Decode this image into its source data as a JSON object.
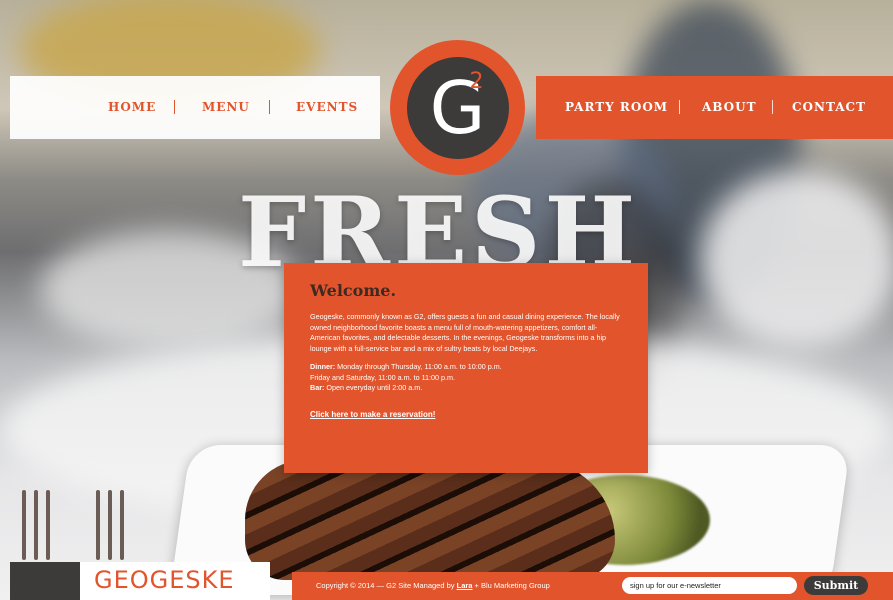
{
  "nav": {
    "left": [
      "HOME",
      "MENU",
      "EVENTS"
    ],
    "right": [
      "PARTY ROOM",
      "ABOUT",
      "CONTACT"
    ]
  },
  "logo": {
    "letter": "G",
    "superscript": "2"
  },
  "hero": {
    "heading": "FRESH"
  },
  "welcome": {
    "title": "Welcome.",
    "body": "Geogeske, commonly known as G2, offers guests a fun and casual dining experience. The locally owned neighborhood favorite boasts a menu full of mouth-watering appetizers, comfort all-American favorites, and delectable desserts. In the evenings, Geogeske transforms into a hip lounge with a full-service bar and a mix of sultry beats by local Deejays.",
    "dinner_label": "Dinner:",
    "dinner_hours": " Monday through Thursday, 11:00 a.m. to 10:00 p.m.",
    "weekend_hours": "Friday and Saturday, 11:00 a.m. to 11:00 p.m.",
    "bar_label": "Bar:",
    "bar_hours": " Open everyday until 2:00 a.m.",
    "reservation_link": "Click here to make a reservation!"
  },
  "footer": {
    "logo_text": "GEOGESKE",
    "copyright": "Copyright © 2014 — G2   Site Managed by ",
    "managed_link": "Lara",
    "managed_suffix": " + Blu Marketing Group",
    "newsletter_placeholder": "sign up for our e-newsletter",
    "submit_label": "Submit"
  },
  "colors": {
    "brand_orange": "#e2542c",
    "charcoal": "#3d3a3a"
  }
}
